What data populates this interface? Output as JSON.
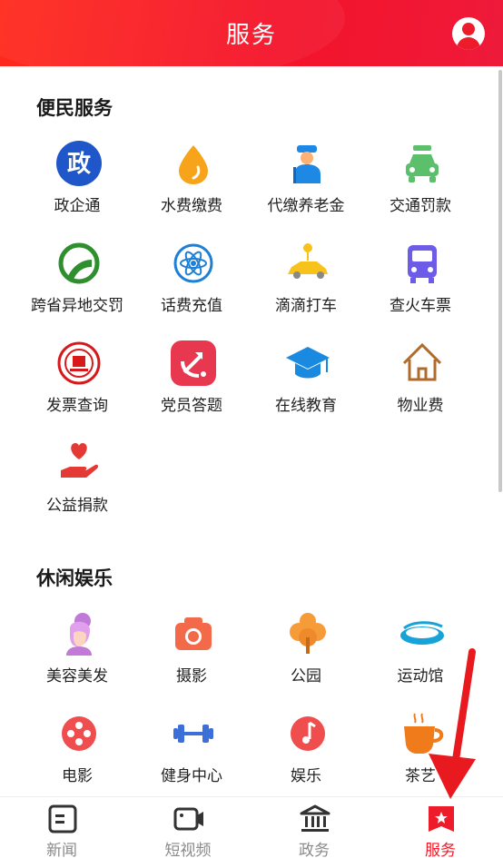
{
  "header": {
    "title": "服务"
  },
  "sections": [
    {
      "title": "便民服务",
      "items": [
        {
          "label": "政企通",
          "icon": "gov-icon"
        },
        {
          "label": "水费缴费",
          "icon": "water-drop-icon"
        },
        {
          "label": "代缴养老金",
          "icon": "elder-person-icon"
        },
        {
          "label": "交通罚款",
          "icon": "car-icon"
        },
        {
          "label": "跨省异地交罚",
          "icon": "road-icon"
        },
        {
          "label": "话费充值",
          "icon": "atom-icon"
        },
        {
          "label": "滴滴打车",
          "icon": "taxi-icon"
        },
        {
          "label": "查火车票",
          "icon": "train-icon"
        },
        {
          "label": "发票查询",
          "icon": "emblem-icon"
        },
        {
          "label": "党员答题",
          "icon": "party-icon"
        },
        {
          "label": "在线教育",
          "icon": "graduation-cap-icon"
        },
        {
          "label": "物业费",
          "icon": "house-icon"
        },
        {
          "label": "公益捐款",
          "icon": "charity-hand-icon"
        }
      ]
    },
    {
      "title": "休闲娱乐",
      "items": [
        {
          "label": "美容美发",
          "icon": "beauty-icon"
        },
        {
          "label": "摄影",
          "icon": "camera-icon"
        },
        {
          "label": "公园",
          "icon": "tree-icon"
        },
        {
          "label": "运动馆",
          "icon": "stadium-icon"
        },
        {
          "label": "电影",
          "icon": "film-reel-icon"
        },
        {
          "label": "健身中心",
          "icon": "dumbbell-icon"
        },
        {
          "label": "娱乐",
          "icon": "music-note-icon"
        },
        {
          "label": "茶艺",
          "icon": "tea-cup-icon"
        }
      ]
    }
  ],
  "tabs": [
    {
      "label": "新闻",
      "icon": "news-icon",
      "active": false
    },
    {
      "label": "短视频",
      "icon": "video-camera-icon",
      "active": false
    },
    {
      "label": "政务",
      "icon": "government-building-icon",
      "active": false
    },
    {
      "label": "服务",
      "icon": "bookmark-star-icon",
      "active": true
    }
  ],
  "colors": {
    "brand": "#ee1b2a",
    "inactive_tab": "#8a8a8a"
  }
}
